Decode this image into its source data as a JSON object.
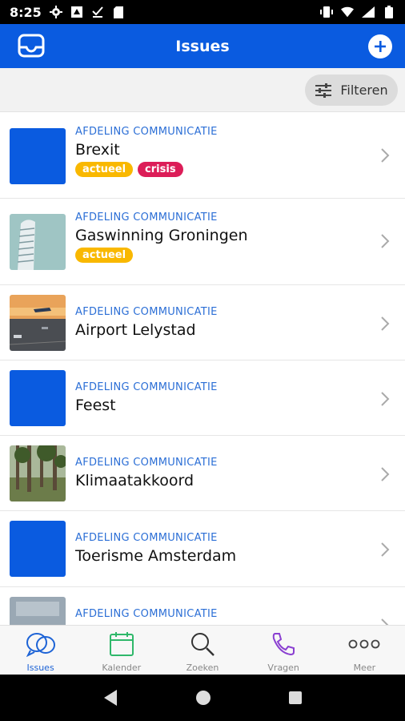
{
  "status": {
    "time": "8:25"
  },
  "appbar": {
    "title": "Issues"
  },
  "filter": {
    "label": "Filteren"
  },
  "issues": [
    {
      "dept": "AFDELING COMMUNICATIE",
      "title": "Brexit",
      "thumb": "blue",
      "tags": [
        "actueel",
        "crisis"
      ]
    },
    {
      "dept": "AFDELING COMMUNICATIE",
      "title": "Gaswinning Groningen",
      "thumb": "building-photo",
      "tags": [
        "actueel"
      ]
    },
    {
      "dept": "AFDELING COMMUNICATIE",
      "title": "Airport Lelystad",
      "thumb": "airport-photo",
      "tags": []
    },
    {
      "dept": "AFDELING COMMUNICATIE",
      "title": "Feest",
      "thumb": "blue",
      "tags": []
    },
    {
      "dept": "AFDELING COMMUNICATIE",
      "title": "Klimaatakkoord",
      "thumb": "forest-photo",
      "tags": []
    },
    {
      "dept": "AFDELING COMMUNICATIE",
      "title": "Toerisme Amsterdam",
      "thumb": "blue",
      "tags": []
    },
    {
      "dept": "AFDELING COMMUNICATIE",
      "title": "",
      "thumb": "sign-photo",
      "tags": []
    }
  ],
  "tag_colors": {
    "actueel": "#f9b800",
    "crisis": "#dc1d58"
  },
  "tabs": [
    {
      "label": "Issues",
      "icon": "chat-bubbles-icon",
      "color": "#1d63d6",
      "active": true
    },
    {
      "label": "Kalender",
      "icon": "calendar-icon",
      "color": "#2fb86a",
      "active": false
    },
    {
      "label": "Zoeken",
      "icon": "search-icon",
      "color": "#333333",
      "active": false
    },
    {
      "label": "Vragen",
      "icon": "phone-icon",
      "color": "#8a3fd1",
      "active": false
    },
    {
      "label": "Meer",
      "icon": "more-icon",
      "color": "#444444",
      "active": false
    }
  ],
  "colors": {
    "brand": "#0a5be0",
    "dept_text": "#2c6fd6"
  }
}
